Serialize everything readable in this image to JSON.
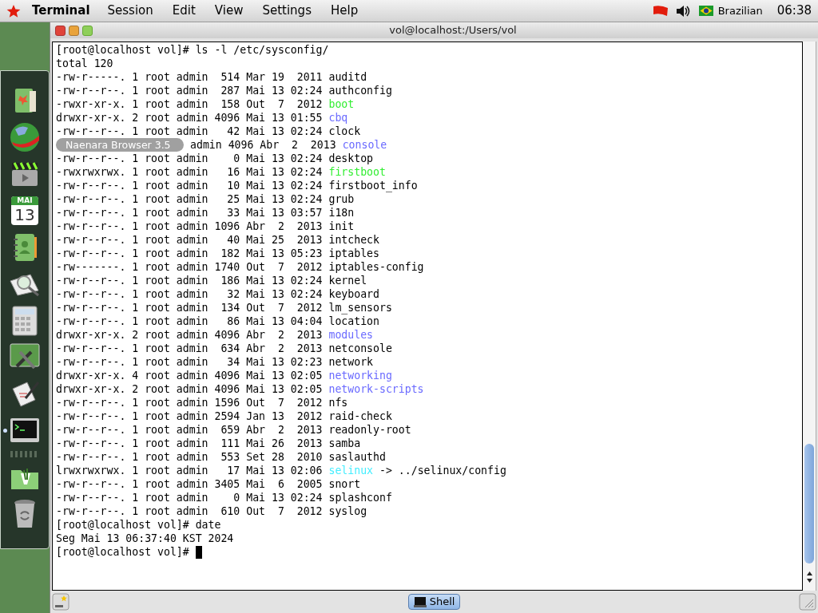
{
  "menubar": {
    "app": "Terminal",
    "menus": [
      "Session",
      "Edit",
      "View",
      "Settings",
      "Help"
    ],
    "keyboard": "Brazilian",
    "clock": "06:38"
  },
  "dock": [
    {
      "kind": "folder",
      "running": false
    },
    {
      "kind": "globe",
      "running": false
    },
    {
      "kind": "video",
      "running": false
    },
    {
      "kind": "calendar",
      "month": "MAI",
      "day": "13",
      "running": false
    },
    {
      "kind": "contacts",
      "running": false
    },
    {
      "kind": "viewer",
      "running": false
    },
    {
      "kind": "calculator",
      "running": false
    },
    {
      "kind": "tools",
      "running": false
    },
    {
      "kind": "editor",
      "running": false
    },
    {
      "kind": "terminal",
      "running": true
    },
    {
      "kind": "separator"
    },
    {
      "kind": "files",
      "running": false
    },
    {
      "kind": "trash",
      "running": false
    }
  ],
  "window": {
    "title": "vol@localhost:/Users/vol"
  },
  "terminal": {
    "lines": [
      {
        "text": "[root@localhost vol]# ls -l /etc/sysconfig/"
      },
      {
        "text": "total 120"
      },
      {
        "meta": "-rw-r-----. 1 root admin  514 Mar 19  2011",
        "name": "auditd",
        "kind": "file"
      },
      {
        "meta": "-rw-r--r--. 1 root admin  287 Mai 13 02:24",
        "name": "authconfig",
        "kind": "file"
      },
      {
        "meta": "-rwxr-xr-x. 1 root admin  158 Out  7  2012",
        "name": "boot",
        "kind": "exec"
      },
      {
        "meta": "drwxr-xr-x. 2 root admin 4096 Mai 13 01:55",
        "name": "cbq",
        "kind": "dir"
      },
      {
        "meta": "-rw-r--r--. 1 root admin   42 Mai 13 02:24",
        "name": "clock",
        "kind": "file"
      },
      {
        "tooltip": "Naenara Browser 3.5",
        "meta": "admin 4096 Abr  2  2013",
        "name": "console",
        "kind": "dir"
      },
      {
        "meta": "-rw-r--r--. 1 root admin    0 Mai 13 02:24",
        "name": "desktop",
        "kind": "file"
      },
      {
        "meta": "-rwxrwxrwx. 1 root admin   16 Mai 13 02:24",
        "name": "firstboot",
        "kind": "exec"
      },
      {
        "meta": "-rw-r--r--. 1 root admin   10 Mai 13 02:24",
        "name": "firstboot_info",
        "kind": "file"
      },
      {
        "meta": "-rw-r--r--. 1 root admin   25 Mai 13 02:24",
        "name": "grub",
        "kind": "file"
      },
      {
        "meta": "-rw-r--r--. 1 root admin   33 Mai 13 03:57",
        "name": "i18n",
        "kind": "file"
      },
      {
        "meta": "-rw-r--r--. 1 root admin 1096 Abr  2  2013",
        "name": "init",
        "kind": "file"
      },
      {
        "meta": "-rw-r--r--. 1 root admin   40 Mai 25  2013",
        "name": "intcheck",
        "kind": "file"
      },
      {
        "meta": "-rw-r--r--. 1 root admin  182 Mai 13 05:23",
        "name": "iptables",
        "kind": "file"
      },
      {
        "meta": "-rw-------. 1 root admin 1740 Out  7  2012",
        "name": "iptables-config",
        "kind": "file"
      },
      {
        "meta": "-rw-r--r--. 1 root admin  186 Mai 13 02:24",
        "name": "kernel",
        "kind": "file"
      },
      {
        "meta": "-rw-r--r--. 1 root admin   32 Mai 13 02:24",
        "name": "keyboard",
        "kind": "file"
      },
      {
        "meta": "-rw-r--r--. 1 root admin  134 Out  7  2012",
        "name": "lm_sensors",
        "kind": "file"
      },
      {
        "meta": "-rw-r--r--. 1 root admin   86 Mai 13 04:04",
        "name": "location",
        "kind": "file"
      },
      {
        "meta": "drwxr-xr-x. 2 root admin 4096 Abr  2  2013",
        "name": "modules",
        "kind": "dir"
      },
      {
        "meta": "-rw-r--r--. 1 root admin  634 Abr  2  2013",
        "name": "netconsole",
        "kind": "file"
      },
      {
        "meta": "-rw-r--r--. 1 root admin   34 Mai 13 02:23",
        "name": "network",
        "kind": "file"
      },
      {
        "meta": "drwxr-xr-x. 4 root admin 4096 Mai 13 02:05",
        "name": "networking",
        "kind": "dir"
      },
      {
        "meta": "drwxr-xr-x. 2 root admin 4096 Mai 13 02:05",
        "name": "network-scripts",
        "kind": "dir"
      },
      {
        "meta": "-rw-r--r--. 1 root admin 1596 Out  7  2012",
        "name": "nfs",
        "kind": "file"
      },
      {
        "meta": "-rw-r--r--. 1 root admin 2594 Jan 13  2012",
        "name": "raid-check",
        "kind": "file"
      },
      {
        "meta": "-rw-r--r--. 1 root admin  659 Abr  2  2013",
        "name": "readonly-root",
        "kind": "file"
      },
      {
        "meta": "-rw-r--r--. 1 root admin  111 Mai 26  2013",
        "name": "samba",
        "kind": "file"
      },
      {
        "meta": "-rw-r--r--. 1 root admin  553 Set 28  2010",
        "name": "saslauthd",
        "kind": "file"
      },
      {
        "meta": "lrwxrwxrwx. 1 root admin   17 Mai 13 02:06",
        "name": "selinux",
        "kind": "link",
        "target": "-> ../selinux/config"
      },
      {
        "meta": "-rw-r--r--. 1 root admin 3405 Mai  6  2005",
        "name": "snort",
        "kind": "file"
      },
      {
        "meta": "-rw-r--r--. 1 root admin    0 Mai 13 02:24",
        "name": "splashconf",
        "kind": "file"
      },
      {
        "meta": "-rw-r--r--. 1 root admin  610 Out  7  2012",
        "name": "syslog",
        "kind": "file"
      },
      {
        "text": "[root@localhost vol]# date"
      },
      {
        "text": "Seg Mai 13 06:37:40 KST 2024"
      },
      {
        "text": "[root@localhost vol]#",
        "cursor": true
      }
    ]
  },
  "tabs": [
    {
      "label": "Shell",
      "selected": true
    }
  ]
}
